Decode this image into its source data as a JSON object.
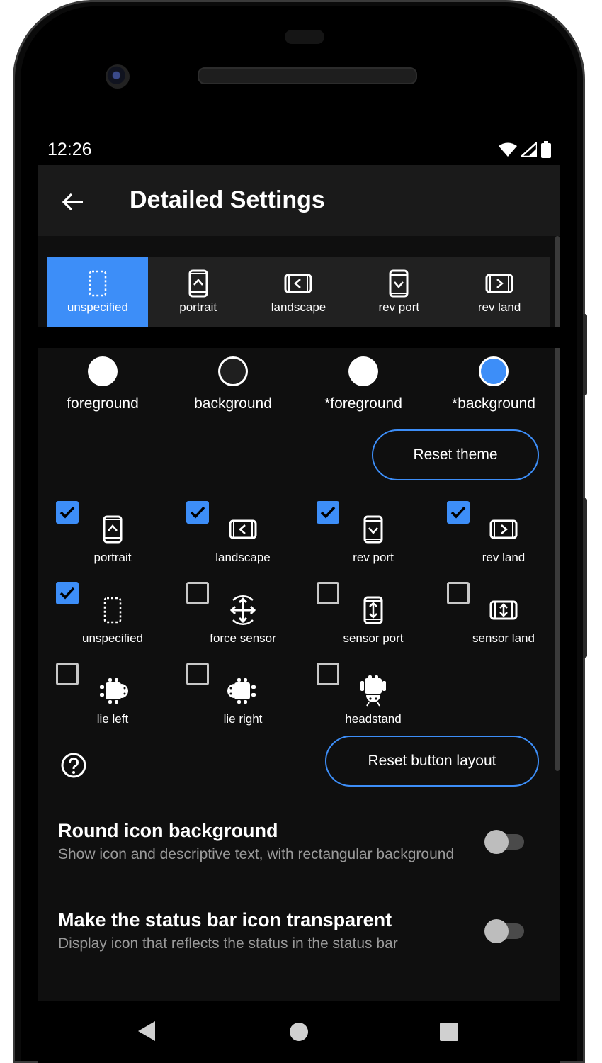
{
  "status_bar": {
    "time": "12:26"
  },
  "app_bar": {
    "title": "Detailed Settings"
  },
  "orientation_tabs": [
    {
      "label": "unspecified",
      "icon": "dotted-rect-icon",
      "selected": true
    },
    {
      "label": "portrait",
      "icon": "portrait-phone-icon",
      "selected": false
    },
    {
      "label": "landscape",
      "icon": "landscape-phone-icon",
      "selected": false
    },
    {
      "label": "rev port",
      "icon": "reverse-portrait-icon",
      "selected": false
    },
    {
      "label": "rev land",
      "icon": "reverse-landscape-icon",
      "selected": false
    }
  ],
  "colors": [
    {
      "label": "foreground",
      "color": "#ffffff"
    },
    {
      "label": "background",
      "color": "#1f1f1f"
    },
    {
      "label": "*foreground",
      "color": "#ffffff"
    },
    {
      "label": "*background",
      "color": "#3d8ef8"
    }
  ],
  "reset_theme_label": "Reset theme",
  "orientation_options": [
    {
      "label": "portrait",
      "checked": true,
      "icon": "portrait-phone-icon"
    },
    {
      "label": "landscape",
      "checked": true,
      "icon": "landscape-phone-icon"
    },
    {
      "label": "rev port",
      "checked": true,
      "icon": "reverse-portrait-icon"
    },
    {
      "label": "rev land",
      "checked": true,
      "icon": "reverse-landscape-icon"
    },
    {
      "label": "unspecified",
      "checked": true,
      "icon": "dotted-rect-icon"
    },
    {
      "label": "force sensor",
      "checked": false,
      "icon": "rotate-arrows-icon"
    },
    {
      "label": "sensor port",
      "checked": false,
      "icon": "sensor-portrait-icon"
    },
    {
      "label": "sensor land",
      "checked": false,
      "icon": "sensor-landscape-icon"
    },
    {
      "label": "lie left",
      "checked": false,
      "icon": "android-lie-left-icon"
    },
    {
      "label": "lie right",
      "checked": false,
      "icon": "android-lie-right-icon"
    },
    {
      "label": "headstand",
      "checked": false,
      "icon": "android-headstand-icon"
    }
  ],
  "reset_layout_label": "Reset button layout",
  "settings": [
    {
      "title": "Round icon background",
      "subtitle": "Show icon and descriptive text, with rectangular background",
      "enabled": false
    },
    {
      "title": "Make the status bar icon transparent",
      "subtitle": "Display icon that reflects the status in the status bar",
      "enabled": false
    }
  ],
  "accent_color": "#3d8ef8"
}
